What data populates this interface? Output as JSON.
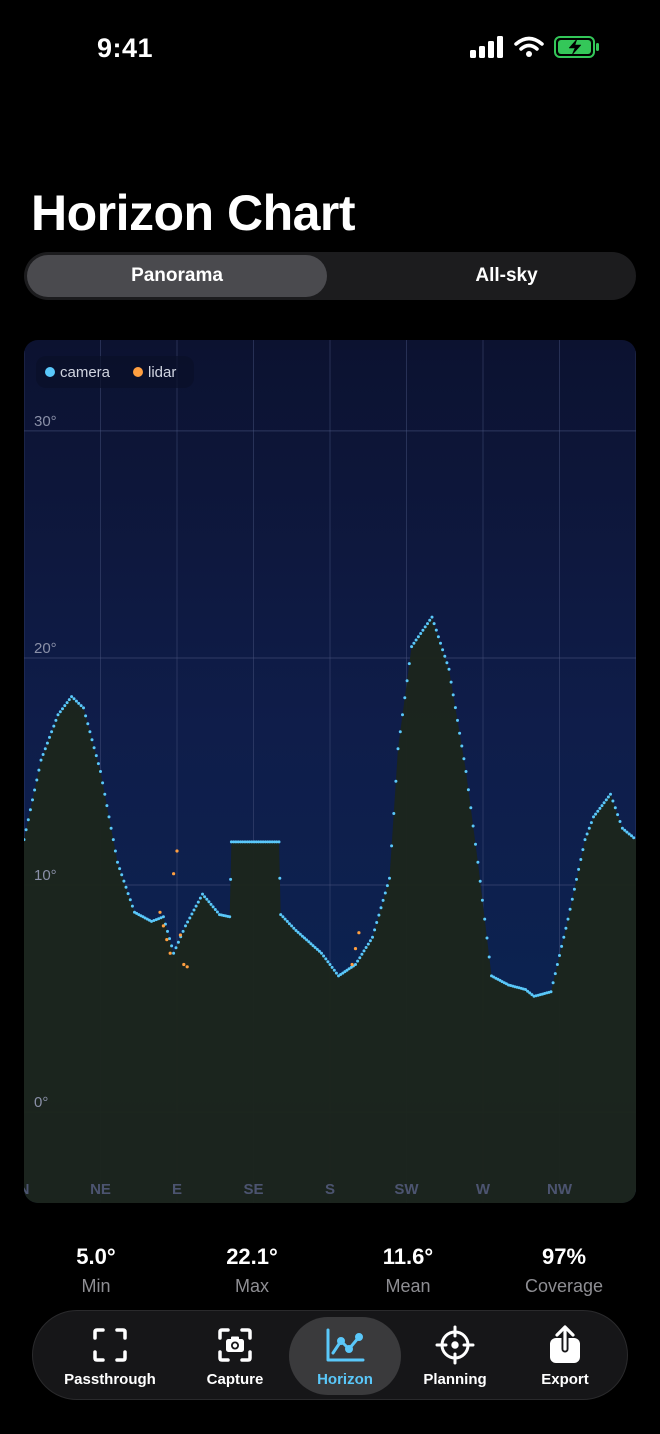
{
  "status": {
    "time": "9:41"
  },
  "title": "Horizon Chart",
  "segments": [
    {
      "label": "Panorama",
      "selected": true
    },
    {
      "label": "All-sky",
      "selected": false
    }
  ],
  "chart_data": {
    "type": "area",
    "legend": [
      {
        "name": "camera",
        "color": "#5ac8fa"
      },
      {
        "name": "lidar",
        "color": "#ff9f40"
      }
    ],
    "legend_position": "top-left",
    "y_ticks": [
      "30°",
      "20°",
      "10°",
      "0°"
    ],
    "y_tick_values": [
      30,
      20,
      10,
      0
    ],
    "ylim": [
      -4,
      34
    ],
    "xlim": [
      0,
      360
    ],
    "x_ticks": [
      "N",
      "NE",
      "E",
      "SE",
      "S",
      "SW",
      "W",
      "NW"
    ],
    "x_tick_values": [
      0,
      45,
      90,
      135,
      180,
      225,
      270,
      315
    ],
    "grid": true,
    "series": [
      {
        "name": "camera",
        "color": "#5ac8fa",
        "x": [
          0,
          10,
          20,
          28,
          35,
          45,
          55,
          65,
          75,
          82,
          88,
          95,
          105,
          115,
          121,
          122,
          130,
          150,
          151,
          160,
          175,
          185,
          195,
          205,
          215,
          220,
          228,
          240,
          250,
          260,
          267,
          275,
          285,
          295,
          300,
          310,
          320,
          330,
          335,
          345,
          352,
          360
        ],
        "y": [
          12,
          15.5,
          17.5,
          18.3,
          17.8,
          15,
          11,
          8.8,
          8.4,
          8.6,
          7,
          8.2,
          9.6,
          8.7,
          8.6,
          11.9,
          11.9,
          11.9,
          8.7,
          8,
          7,
          6,
          6.5,
          7.7,
          10.3,
          16,
          20.5,
          21.8,
          19.5,
          15,
          11,
          6,
          5.6,
          5.4,
          5.1,
          5.3,
          8.5,
          12,
          13,
          14,
          12.5,
          12
        ]
      },
      {
        "name": "lidar",
        "color": "#ff9f40",
        "x": [
          80,
          82,
          84,
          86,
          88,
          90,
          92,
          94,
          96,
          193,
          195,
          197
        ],
        "y": [
          8.8,
          8.2,
          7.6,
          7.0,
          10.5,
          11.5,
          7.8,
          6.5,
          6.4,
          6.5,
          7.2,
          7.9
        ]
      }
    ]
  },
  "stats": [
    {
      "value": "5.0°",
      "label": "Min"
    },
    {
      "value": "22.1°",
      "label": "Max"
    },
    {
      "value": "11.6°",
      "label": "Mean"
    },
    {
      "value": "97%",
      "label": "Coverage"
    }
  ],
  "tabs": [
    {
      "label": "Passthrough",
      "icon": "viewfinder-icon",
      "selected": false
    },
    {
      "label": "Capture",
      "icon": "camera-icon",
      "selected": false
    },
    {
      "label": "Horizon",
      "icon": "chart-line-icon",
      "selected": true
    },
    {
      "label": "Planning",
      "icon": "crosshair-icon",
      "selected": false
    },
    {
      "label": "Export",
      "icon": "share-icon",
      "selected": false
    }
  ],
  "colors": {
    "accent": "#5ac8fa",
    "camera": "#5ac8fa",
    "lidar": "#ff9f40",
    "terrain": "#1c251d"
  }
}
